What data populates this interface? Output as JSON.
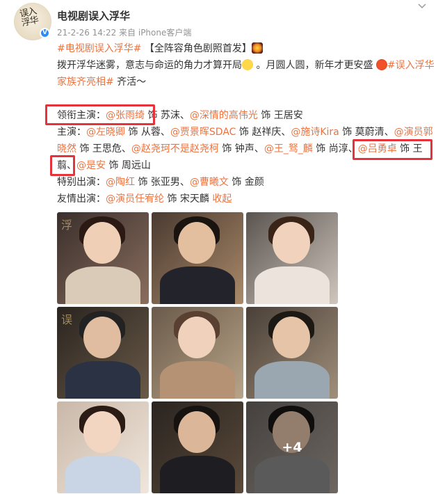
{
  "post": {
    "username": "电视剧误入浮华",
    "meta": "21-2-26 14:22  来自 iPhone客户端",
    "avatar_text": "误入浮华",
    "lines": [
      [
        {
          "t": "#电视剧误入浮华#",
          "link": true
        },
        {
          "t": " 【全阵容角色剧照首发】"
        }
      ],
      [
        {
          "t": "拨开浮华迷雾，意志与命运的角力才算开局"
        },
        {
          "t": " 。月圆人圆，新年才更安盛 "
        },
        {
          "t": "#误入浮华",
          "link": true
        }
      ],
      [
        {
          "t": "家族齐亮相#",
          "link": true
        },
        {
          "t": " 齐活～"
        }
      ],
      [],
      [
        {
          "t": "领衔主演："
        },
        {
          "t": "@张雨绮",
          "link": true
        },
        {
          "t": " 饰 苏沫、"
        },
        {
          "t": "@深情的高伟光",
          "link": true
        },
        {
          "t": " 饰 王居安"
        }
      ],
      [
        {
          "t": "主演："
        },
        {
          "t": "@左晓卿",
          "link": true
        },
        {
          "t": " 饰 从蓉、"
        },
        {
          "t": "@贾景晖SDAC",
          "link": true
        },
        {
          "t": " 饰 赵祥庆、"
        },
        {
          "t": "@施诗Kira",
          "link": true
        },
        {
          "t": " 饰 莫蔚清、"
        },
        {
          "t": "@演员郭",
          "link": true
        }
      ],
      [
        {
          "t": "晓然",
          "link": true
        },
        {
          "t": " 饰 王思危、"
        },
        {
          "t": "@赵尧珂不是赵尧柯",
          "link": true
        },
        {
          "t": " 饰 钟声、"
        },
        {
          "t": "@王_驽_麟",
          "link": true
        },
        {
          "t": " 饰 尚淳、"
        },
        {
          "t": "@吕勇卓",
          "link": true
        },
        {
          "t": " 饰 王"
        }
      ],
      [
        {
          "t": "翦"
        },
        {
          "t": "、"
        },
        {
          "t": "@是安",
          "link": true
        },
        {
          "t": " 饰 周远山"
        }
      ],
      [
        {
          "t": "特别出演："
        },
        {
          "t": "@陶红",
          "link": true
        },
        {
          "t": " 饰 张亚男、"
        },
        {
          "t": "@曹曦文",
          "link": true
        },
        {
          "t": " 饰 金颜"
        }
      ],
      [
        {
          "t": "友情出演："
        },
        {
          "t": "@演员任宥纶",
          "link": true
        },
        {
          "t": " 饰 宋天麟 "
        },
        {
          "t": "收起",
          "link": true
        }
      ]
    ],
    "photo_more_label": "+4"
  },
  "colors": {
    "link": "#eb7340",
    "highlight_box": "#e5333b",
    "meta_text": "#939393",
    "verified_badge": "#2f8cf5"
  },
  "icons": [
    "verified-icon",
    "chevron-down-icon",
    "sunglasses-emoji-icon",
    "fireworks-emoji-icon",
    "lantern-emoji-icon"
  ]
}
